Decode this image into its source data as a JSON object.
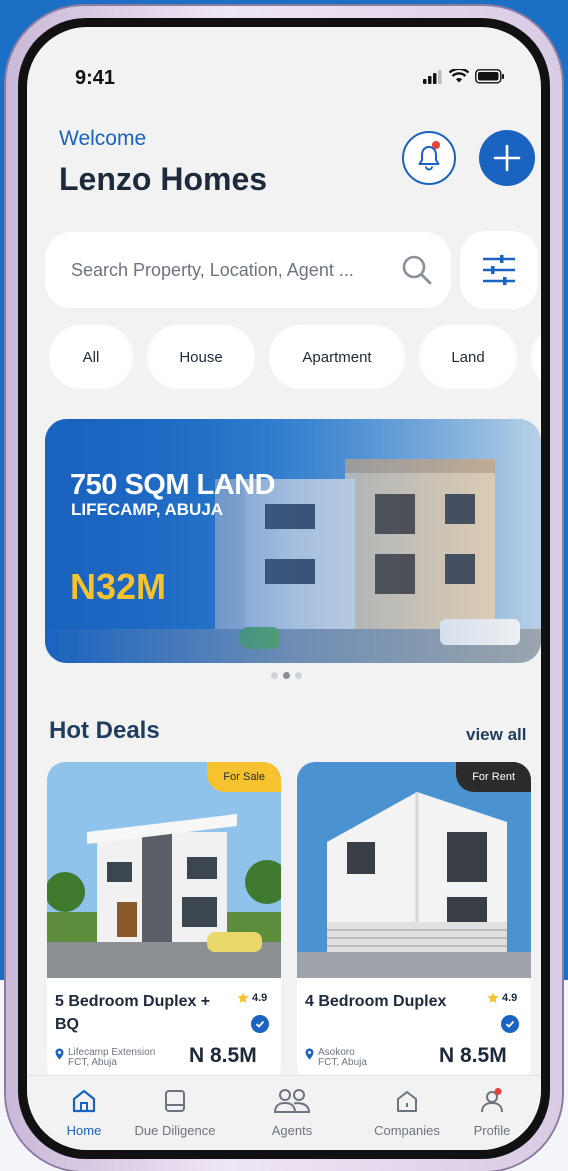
{
  "status": {
    "time": "9:41"
  },
  "header": {
    "welcome": "Welcome",
    "brand": "Lenzo Homes"
  },
  "search": {
    "placeholder": "Search Property, Location, Agent ..."
  },
  "categories": [
    "All",
    "House",
    "Apartment",
    "Land"
  ],
  "banner": {
    "title": "750 SQM LAND",
    "subtitle": "LIFECAMP, ABUJA",
    "price": "N32M",
    "slides": 3,
    "active_slide": 2
  },
  "hot_deals": {
    "title": "Hot Deals",
    "view_all": "view all",
    "items": [
      {
        "tag": "For Sale",
        "title": "5 Bedroom Duplex + BQ",
        "rating": "4.9",
        "location_line1": "Lifecamp Extension",
        "location_line2": "FCT, Abuja",
        "price": "N 8.5M",
        "tag_color": "#f6c22d"
      },
      {
        "tag": "For Rent",
        "title": "4 Bedroom Duplex",
        "rating": "4.9",
        "location_line1": "Asokoro",
        "location_line2": "FCT, Abuja",
        "price": "N 8.5M",
        "tag_color": "#2b2b2b"
      }
    ]
  },
  "tabs": [
    {
      "label": "Home",
      "icon": "home-icon",
      "active": true
    },
    {
      "label": "Due Diligence",
      "icon": "book-icon",
      "active": false
    },
    {
      "label": "Agents",
      "icon": "agents-icon",
      "active": false
    },
    {
      "label": "Companies",
      "icon": "building-icon",
      "active": false
    },
    {
      "label": "Profile",
      "icon": "profile-icon",
      "active": false
    }
  ],
  "colors": {
    "primary": "#1a63c0",
    "accent": "#f6c22d",
    "dark": "#1d2a3a"
  }
}
